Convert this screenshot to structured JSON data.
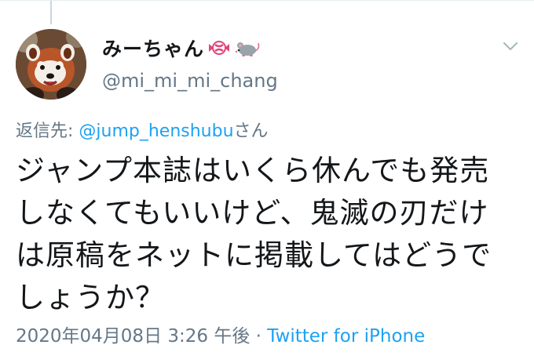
{
  "author": {
    "display_name": "みーちゃん",
    "username": "@mi_mi_mi_chang",
    "emoji_icons": [
      "candy-icon",
      "mouse-icon"
    ]
  },
  "reply": {
    "prefix": "返信先: ",
    "mention": "@jump_henshubu",
    "suffix": "さん"
  },
  "tweet": {
    "lines": [
      "ジャンプ本誌はいくら休んでも発売",
      "しなくてもいいけど、鬼滅の刃だけ",
      "は原稿をネットに掲載してはどうで",
      "しょうか？"
    ]
  },
  "meta": {
    "timestamp": "2020年04月08日 3:26 午後",
    "separator": " · ",
    "source": "Twitter for iPhone"
  },
  "colors": {
    "link": "#1da1f2",
    "secondary": "#657786",
    "text": "#14171a"
  }
}
